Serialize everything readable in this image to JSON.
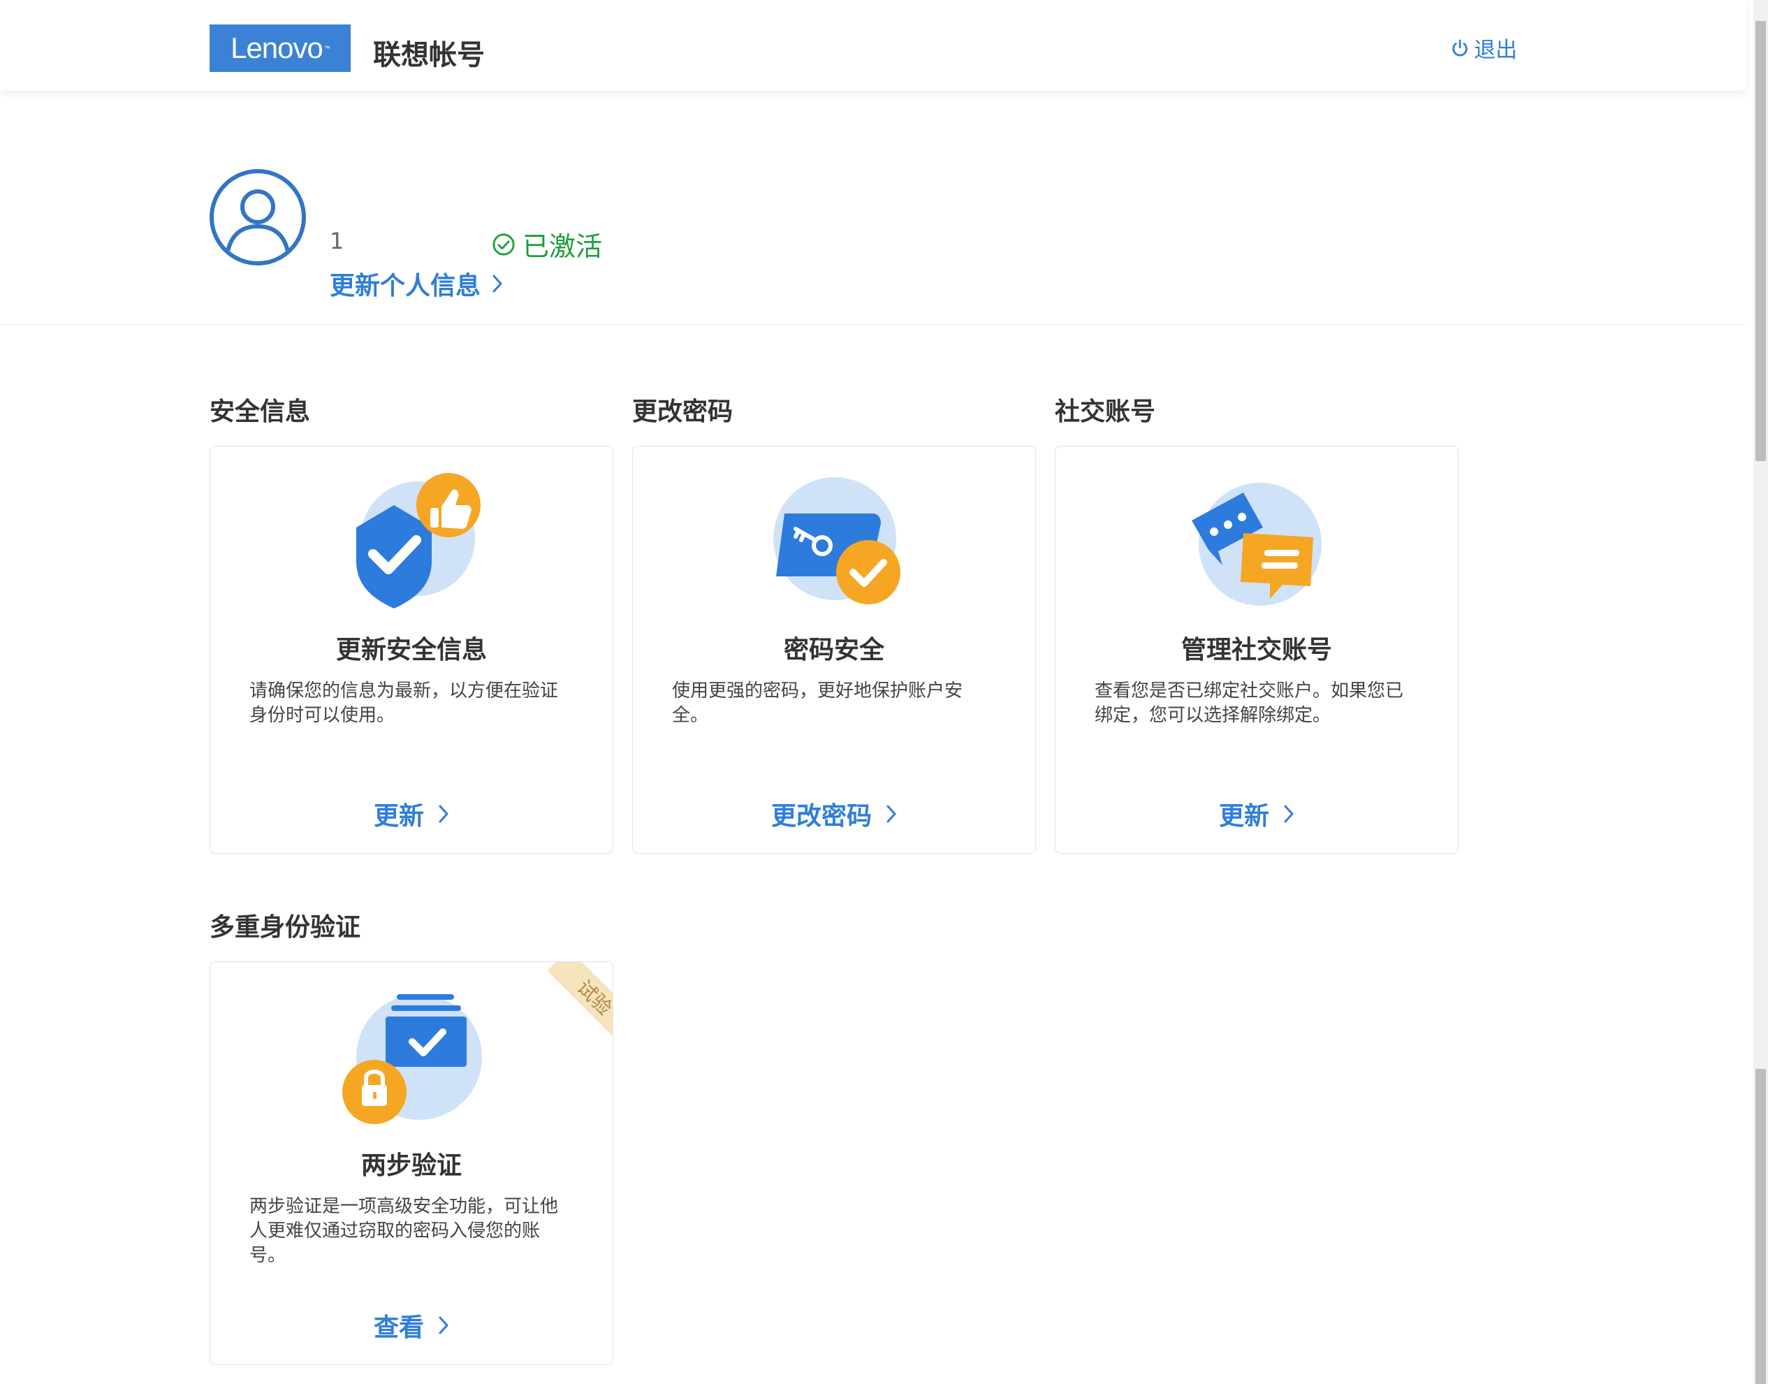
{
  "header": {
    "logo_text": "Lenovo",
    "app_title": "联想帐号",
    "logout_label": "退出"
  },
  "profile": {
    "account_id": "1",
    "status": "已激活",
    "update_link": "更新个人信息"
  },
  "sections": [
    {
      "title": "安全信息",
      "card": {
        "icon": "security-shield-thumbs-up-icon",
        "title": "更新安全信息",
        "desc": "请确保您的信息为最新，以方便在验证身份时可以使用。",
        "link": "更新"
      }
    },
    {
      "title": "更改密码",
      "card": {
        "icon": "password-key-card-icon",
        "title": "密码安全",
        "desc": "使用更强的密码，更好地保护账户安全。",
        "link": "更改密码"
      }
    },
    {
      "title": "社交账号",
      "card": {
        "icon": "social-chat-bubbles-icon",
        "title": "管理社交账号",
        "desc": "查看您是否已绑定社交账户。如果您已绑定，您可以选择解除绑定。",
        "link": "更新"
      }
    },
    {
      "title": "多重身份验证",
      "card": {
        "icon": "two-step-lock-check-icon",
        "title": "两步验证",
        "desc": "两步验证是一项高级安全功能，可让他人更难仅通过窃取的密码入侵您的账号。",
        "link": "查看",
        "badge": "试验"
      }
    }
  ],
  "colors": {
    "brand": "#3b82d6",
    "link": "#2f7ed8",
    "success": "#1e9e3c",
    "accent_orange": "#f5a623"
  }
}
